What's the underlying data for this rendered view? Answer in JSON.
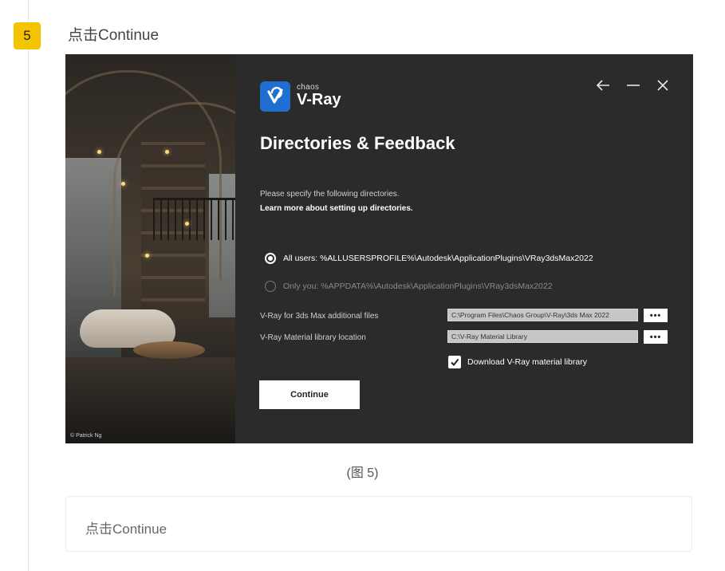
{
  "step": {
    "number": "5",
    "title": "点击Continue"
  },
  "installer": {
    "photo_credit": "© Patrick Ng",
    "brand": {
      "sub": "chaos",
      "name": "V-Ray",
      "accent_color": "#1f6fd1"
    },
    "window_controls": {
      "back_icon": "arrow-left-icon",
      "minimize_icon": "minimize-icon",
      "close_icon": "close-icon"
    },
    "heading": "Directories & Feedback",
    "intro_text": "Please specify the following directories.",
    "learn_more_link": "Learn more about setting up directories.",
    "install_scope": {
      "all_users": {
        "label": "All users: %ALLUSERSPROFILE%\\Autodesk\\ApplicationPlugins\\VRay3dsMax2022",
        "selected": true
      },
      "only_you": {
        "label": "Only you: %APPDATA%\\Autodesk\\ApplicationPlugins\\VRay3dsMax2022",
        "selected": false
      }
    },
    "fields": [
      {
        "label": "V-Ray for 3ds Max additional files",
        "value": "C:\\Program Files\\Chaos Group\\V-Ray\\3ds Max 2022",
        "browse_label": "•••"
      },
      {
        "label": "V-Ray Material library location",
        "value": "C:\\V-Ray Material Library",
        "browse_label": "•••"
      }
    ],
    "download_library": {
      "label": "Download V-Ray material library",
      "checked": true
    },
    "continue_label": "Continue"
  },
  "caption": "(图 5)",
  "note": "点击Continue"
}
